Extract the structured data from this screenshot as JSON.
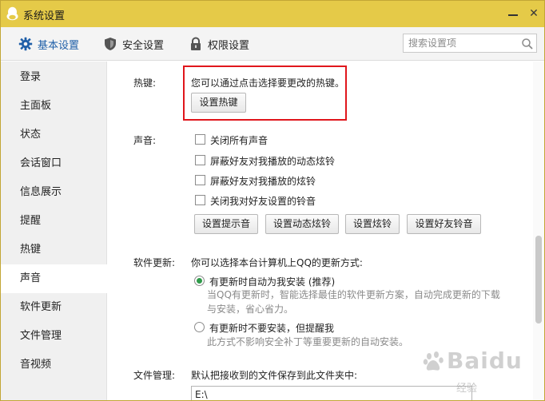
{
  "window": {
    "title": "系统设置",
    "minimize_glyph": "—",
    "close_glyph": "✕"
  },
  "tabs": [
    {
      "label": "基本设置",
      "icon": "gear-icon",
      "active": true
    },
    {
      "label": "安全设置",
      "icon": "shield-icon",
      "active": false
    },
    {
      "label": "权限设置",
      "icon": "lock-icon",
      "active": false
    }
  ],
  "search": {
    "placeholder": "搜索设置项",
    "value": ""
  },
  "sidebar": {
    "items": [
      {
        "label": "登录"
      },
      {
        "label": "主面板"
      },
      {
        "label": "状态"
      },
      {
        "label": "会话窗口"
      },
      {
        "label": "信息展示"
      },
      {
        "label": "提醒"
      },
      {
        "label": "热键"
      },
      {
        "label": "声音",
        "active": true
      },
      {
        "label": "软件更新"
      },
      {
        "label": "文件管理"
      },
      {
        "label": "音视频"
      }
    ]
  },
  "hotkey": {
    "label": "热键:",
    "description": "您可以通过点击选择要更改的热键。",
    "button": "设置热键"
  },
  "sound": {
    "label": "声音:",
    "options": [
      {
        "label": "关闭所有声音",
        "checked": false
      },
      {
        "label": "屏蔽好友对我播放的动态炫铃",
        "checked": false
      },
      {
        "label": "屏蔽好友对我播放的炫铃",
        "checked": false
      },
      {
        "label": "关闭我对好友设置的铃音",
        "checked": false
      }
    ],
    "buttons": [
      "设置提示音",
      "设置动态炫铃",
      "设置炫铃",
      "设置好友铃音"
    ]
  },
  "update": {
    "label": "软件更新:",
    "description": "你可以选择本台计算机上QQ的更新方式:",
    "options": [
      {
        "label": "有更新时自动为我安装 (推荐)",
        "selected": true,
        "desc_line1": "当QQ有更新时，智能选择最佳的软件更新方案，自动完成更新的下载",
        "desc_line2": "与安装，省心省力。"
      },
      {
        "label": "有更新时不要安装，但提醒我",
        "selected": false,
        "desc_line1": "此方式不影响安全补丁等重要更新的自动安装。"
      }
    ]
  },
  "files": {
    "label": "文件管理:",
    "description": "默认把接收到的文件保存到此文件夹中:",
    "path": "E:\\"
  },
  "watermark": {
    "text": "Baidu",
    "sub": "经验"
  },
  "colors": {
    "titlebar": "#e5ca48",
    "accent": "#1f5fa8",
    "highlight": "#e0161c",
    "radio": "#2f9a4a"
  }
}
